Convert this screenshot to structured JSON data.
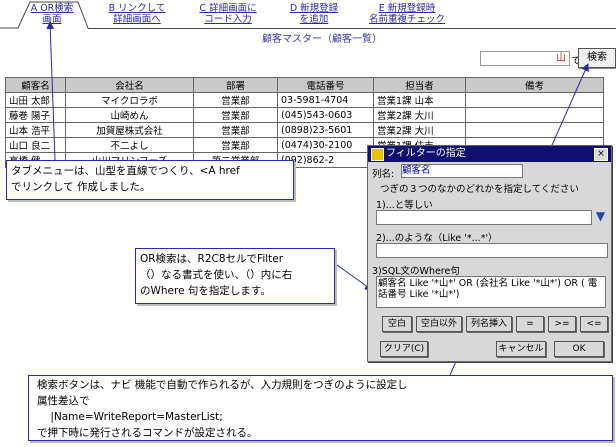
{
  "tabs": [
    {
      "line1": "A OR検索",
      "line2": "画面"
    },
    {
      "line1": "B リンクして",
      "line2": "詳細画面へ"
    },
    {
      "line1": "C 詳細画面に",
      "line2": "コード入力"
    },
    {
      "line1": "D 新規登録",
      "line2": "を追加"
    },
    {
      "line1": "E 新規登録時",
      "line2": "名前重複チェック"
    }
  ],
  "page_title": "顧客マスター（顧客一覧）",
  "search": {
    "value": "山",
    "suffix": "で",
    "button_label": "検索"
  },
  "table": {
    "headers": [
      "顧客名",
      "会社名",
      "部署",
      "電話番号",
      "担当者",
      "備考"
    ],
    "rows": [
      [
        "山田 太郎",
        "マイクロラボ",
        "営業部",
        "03-5981-4704",
        "営業1課 山本",
        ""
      ],
      [
        "藤巻 陽子",
        "山崎めん",
        "営業部",
        "(045)543-0603",
        "営業2課 大川",
        ""
      ],
      [
        "山本 浩平",
        "加賀屋株式会社",
        "営業部",
        "(0898)23-5601",
        "営業2課 大川",
        ""
      ],
      [
        "山口 良二",
        "不二よし",
        "営業部",
        "(0474)30-2100",
        "営業1課 住吉",
        ""
      ],
      [
        "高橋 健",
        "山川マリンフーズ",
        "第二営業部",
        "(092)862-2",
        "",
        ""
      ]
    ]
  },
  "callouts": {
    "tab_note": [
      "タブメニューは、山型を直線でつくり、<A href",
      "でリンクして 作成しました。"
    ],
    "or_note": [
      "OR検索は、R2C8セルでFilter",
      "（）なる書式を使い、（）内に右",
      "のWhere 句を指定します。"
    ],
    "search_note": [
      "検索ボタンは、ナビ 機能で自動で作られるが、入力規則をつぎのように設定し",
      "属性差込で",
      "    |Name=WriteReport=MasterList;",
      "で押下時に発行されるコマンドが設定される。"
    ]
  },
  "dialog": {
    "title": "フィルターの指定",
    "close": "×",
    "column_label": "列名:",
    "column_value": "顧客名",
    "instruction": "つぎの３つのなかのどれかを指定してください",
    "opt1_label": "1)...と等しい",
    "opt2_label": "2)...のような（Like '*...*'）",
    "opt3_label": "3)SQL文のWhere句",
    "sql_text": "顧客名 Like '*山*' OR (会社名 Like '*山*') OR ( 電話番号 Like '*山*')",
    "buttons": [
      "空白",
      "空白以外",
      "列名挿入",
      "=",
      ">=",
      "<="
    ],
    "clear": "クリア(C)",
    "cancel": "キャンセル",
    "ok": "OK"
  }
}
